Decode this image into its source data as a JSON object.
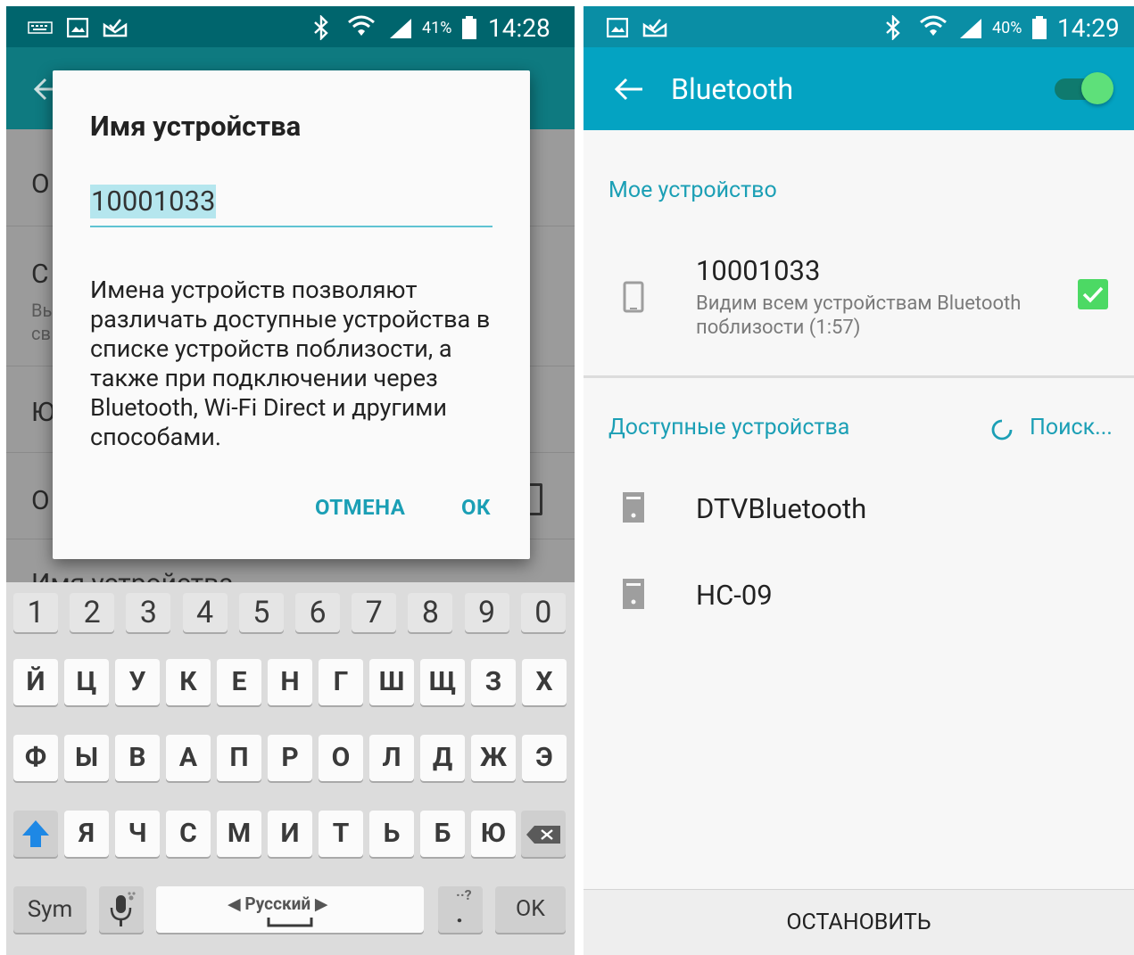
{
  "left": {
    "status": {
      "battery_pct": "41%",
      "time": "14:28"
    },
    "settings_rows": [
      {
        "title": "О"
      },
      {
        "title": "С",
        "sub1": "Вы",
        "sub2": "св"
      },
      {
        "title": "Ю"
      },
      {
        "title": "О"
      },
      {
        "title": "Имя устройства"
      }
    ],
    "dialog": {
      "title": "Имя устройства",
      "input_value": "10001033",
      "body": "Имена устройств позволяют различать доступные устройства в списке устройств поблизости, а также при подключении через Bluetooth, Wi-Fi Direct и другими способами.",
      "cancel_label": "ОТМЕНА",
      "ok_label": "ОК"
    },
    "keyboard": {
      "row_numbers": [
        "1",
        "2",
        "3",
        "4",
        "5",
        "6",
        "7",
        "8",
        "9",
        "0"
      ],
      "row1": [
        "Й",
        "Ц",
        "У",
        "К",
        "Е",
        "Н",
        "Г",
        "Ш",
        "Щ",
        "З",
        "Х"
      ],
      "row2": [
        "Ф",
        "Ы",
        "В",
        "А",
        "П",
        "Р",
        "О",
        "Л",
        "Д",
        "Ж",
        "Э"
      ],
      "row3": [
        "Я",
        "Ч",
        "С",
        "М",
        "И",
        "Т",
        "Ь",
        "Б",
        "Ю"
      ],
      "sym_label": "Sym",
      "space_label": "Русский",
      "ok_label": "OK"
    }
  },
  "right": {
    "status": {
      "battery_pct": "40%",
      "time": "14:29"
    },
    "appbar": {
      "title": "Bluetooth",
      "toggle_on": true
    },
    "my_device": {
      "section_label": "Мое устройство",
      "name": "10001033",
      "sub_line1": "Видим всем устройствам Bluetooth",
      "sub_line2": "поблизости (1:57)",
      "checked": true
    },
    "available": {
      "section_label": "Доступные устройства",
      "search_label": "Поиск...",
      "devices": [
        "DTVBluetooth",
        "HC-09"
      ]
    },
    "stop_label": "ОСТАНОВИТЬ"
  },
  "colors": {
    "accent": "#1b9fb5",
    "appbar_right": "#04a3c2",
    "toggle": "#5ee07a",
    "checkbox": "#4cd964"
  }
}
